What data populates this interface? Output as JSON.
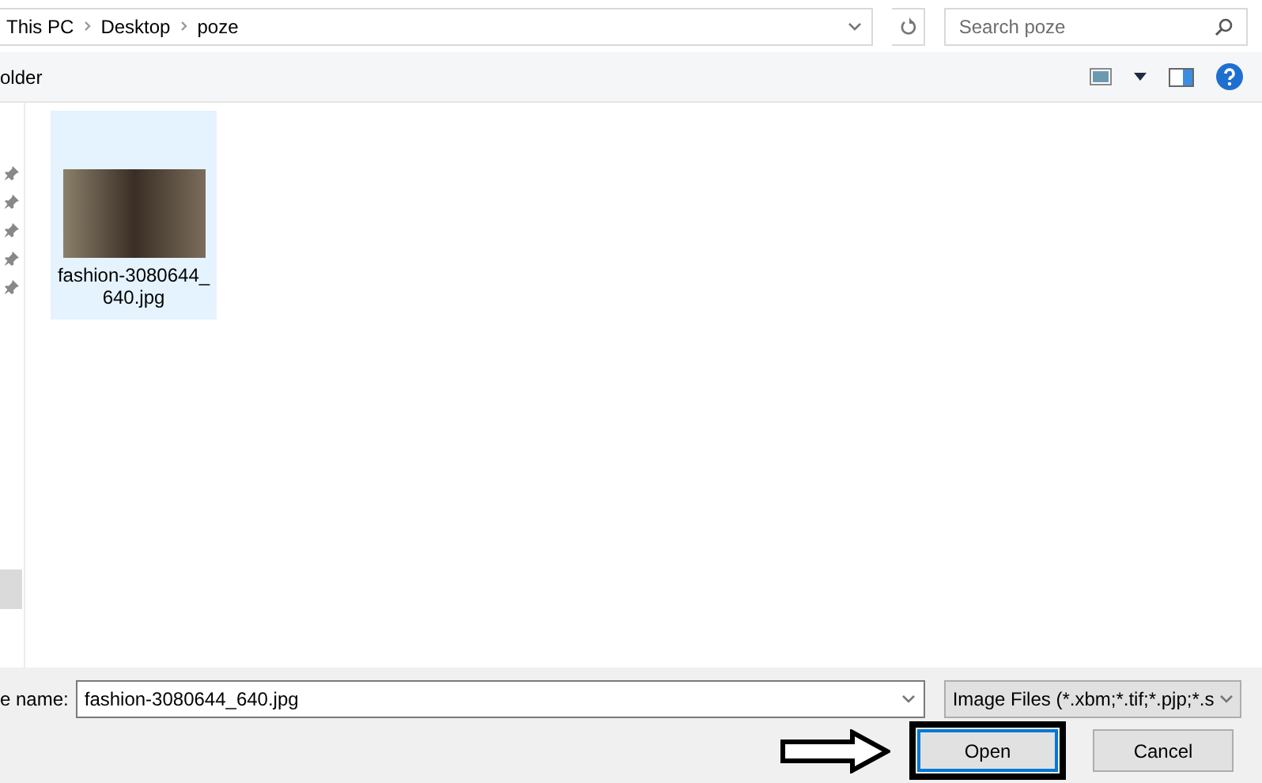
{
  "address_bar": {
    "breadcrumb": [
      "This PC",
      "Desktop",
      "poze"
    ]
  },
  "search": {
    "placeholder": "Search poze"
  },
  "toolbar": {
    "new_folder": "older"
  },
  "files": [
    {
      "name": "fashion-3080644_640.jpg",
      "selected": true
    }
  ],
  "footer": {
    "file_name_label": "e name:",
    "file_name_value": "fashion-3080644_640.jpg",
    "file_type": "Image Files (*.xbm;*.tif;*.pjp;*.s"
  },
  "buttons": [
    {
      "label": "Open",
      "default": true,
      "highlighted": true
    },
    {
      "label": "Cancel",
      "default": false,
      "highlighted": false
    }
  ]
}
